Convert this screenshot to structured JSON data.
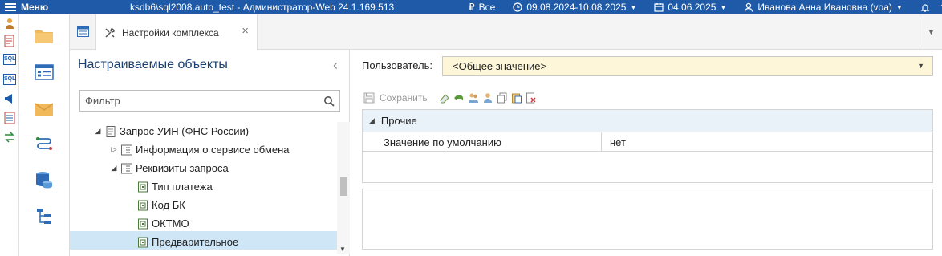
{
  "topbar": {
    "menu_label": "Меню",
    "window_title": "ksdb6\\sql2008.auto_test - Администратор-Web 24.1.169.513",
    "org_filter": "Все",
    "period": "09.08.2024-10.08.2025",
    "date": "04.06.2025",
    "user": "Иванова Анна Ивановна (voa)",
    "color": "#1e5aa8"
  },
  "rail": {
    "icons": [
      "user-tools-icon",
      "report-icon",
      "sql-icon",
      "sql-icon",
      "announce-icon",
      "report-sql-icon",
      "swap-icon"
    ],
    "sql_label": "SQL",
    "sql2_label": "SQL"
  },
  "modules": [
    "folder-icon",
    "list-window-icon",
    "mail-icon",
    "routes-icon",
    "database-icon",
    "tree-structure-icon"
  ],
  "tabs": {
    "active_label": "Настройки комплекса"
  },
  "left_panel": {
    "title": "Настраиваемые объекты",
    "filter_placeholder": "Фильтр",
    "tree": [
      {
        "label": "Запрос УИН (ФНС России)",
        "expanded": true,
        "level": 0
      },
      {
        "label": "Информация о сервисе обмена",
        "expanded": false,
        "level": 1
      },
      {
        "label": "Реквизиты запроса",
        "expanded": true,
        "level": 1
      },
      {
        "label": "Тип платежа",
        "level": 2
      },
      {
        "label": "Код БК",
        "level": 2
      },
      {
        "label": "ОКТМО",
        "level": 2
      },
      {
        "label": "Предварительное",
        "level": 2,
        "selected": true
      }
    ]
  },
  "right_panel": {
    "user_label": "Пользователь:",
    "user_value": "<Общее значение>",
    "save_label": "Сохранить",
    "group_label": "Прочие",
    "param_name": "Значение по умолчанию",
    "param_value": "нет"
  }
}
